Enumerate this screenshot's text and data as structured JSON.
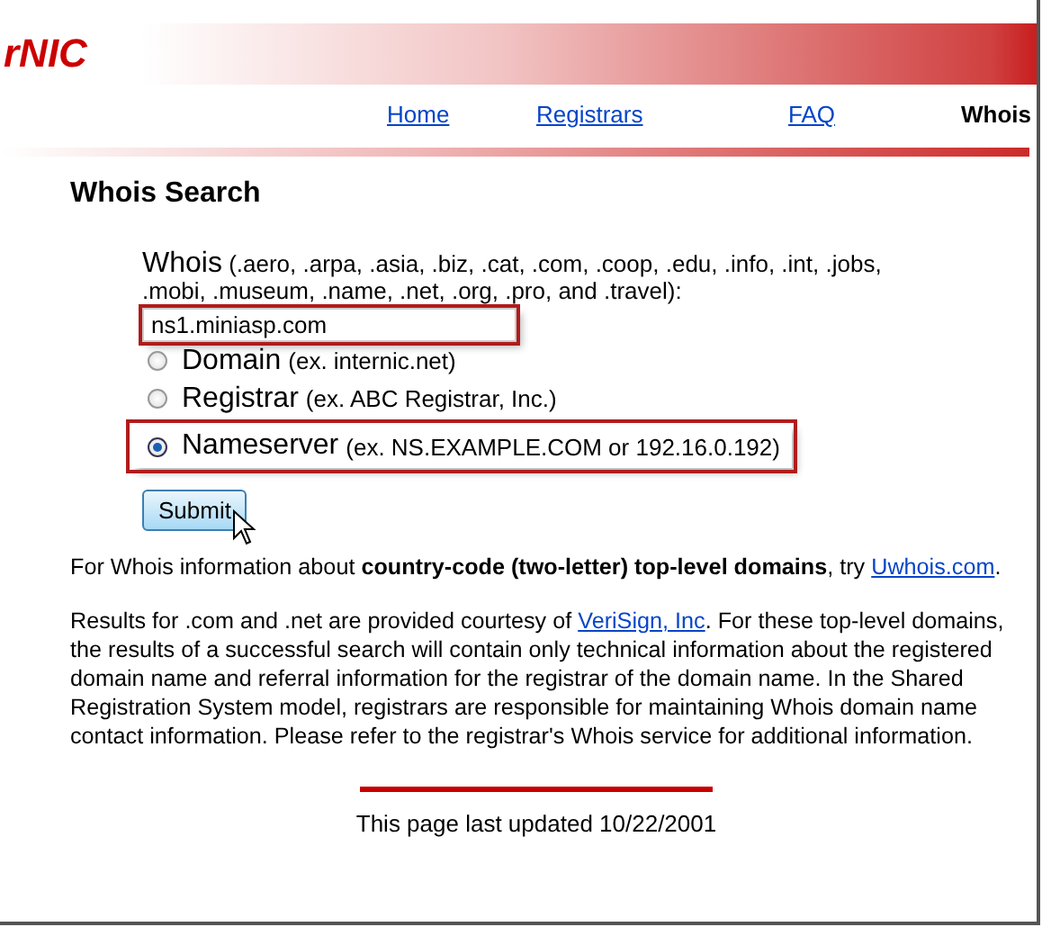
{
  "header": {
    "logo": "rNIC"
  },
  "nav": [
    {
      "label": "Home",
      "selected": false
    },
    {
      "label": "Registrars",
      "selected": false
    },
    {
      "label": "FAQ",
      "selected": false
    },
    {
      "label": "Whois",
      "selected": true
    }
  ],
  "heading": "Whois Search",
  "form": {
    "label": "Whois",
    "label_note": "(.aero, .arpa, .asia, .biz, .cat, .com, .coop, .edu, .info, .int, .jobs, .mobi, .museum, .name, .net, .org, .pro, and .travel):",
    "field": {
      "value": "ns1.miniasp.com",
      "highlighted": true
    },
    "options": [
      {
        "label": "Domain",
        "hint": "(ex. internic.net)",
        "selected": false,
        "highlighted": false
      },
      {
        "label": "Registrar",
        "hint": "(ex. ABC Registrar, Inc.)",
        "selected": false,
        "highlighted": false
      },
      {
        "label": "Nameserver",
        "hint": "(ex. NS.EXAMPLE.COM or 192.16.0.192)",
        "selected": true,
        "highlighted": true
      }
    ],
    "submit": "Submit"
  },
  "paragraphs": [
    [
      {
        "kind": "text",
        "text": "For Whois information about **country-code (two-letter) top-level domains**, try "
      },
      {
        "kind": "link",
        "text": "Uwhois.com"
      },
      {
        "kind": "text",
        "text": "."
      }
    ],
    [
      {
        "kind": "text",
        "text": "Results for .com and .net are provided courtesy of "
      },
      {
        "kind": "link",
        "text": "VeriSign, Inc"
      },
      {
        "kind": "text",
        "text": ". For these top-level domains, the results of a successful search will contain only technical information about the registered domain name and referral information for the registrar of the domain name. In the Shared Registration System model, registrars are responsible for maintaining Whois domain name contact information. Please refer to the registrar's Whois service for additional information."
      }
    ]
  ],
  "footer": "This page last updated 10/22/2001"
}
